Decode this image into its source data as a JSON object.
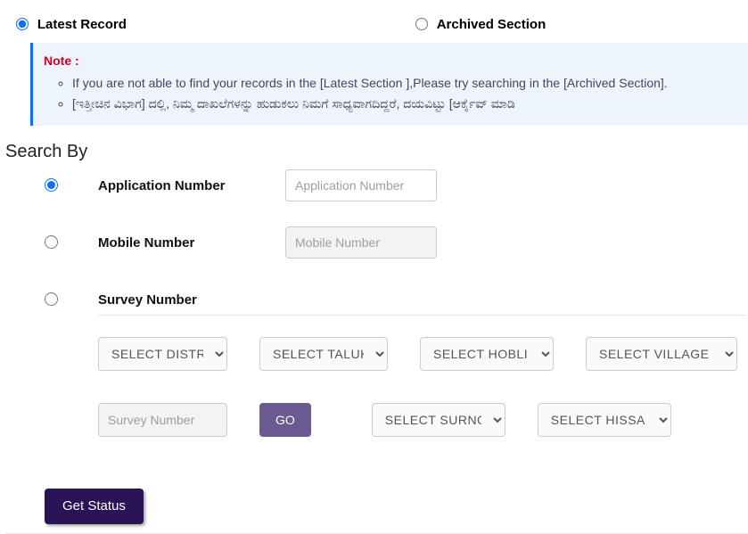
{
  "section_radios": {
    "latest_label": "Latest Record",
    "archived_label": "Archived Section"
  },
  "note": {
    "title": "Note :",
    "line1": "If you are not able to find your records in the [Latest Section ],Please try searching in the [Archived Section].",
    "line2": "[ಇತ್ತೀಚಿನ ವಿಭಾಗ] ದಲ್ಲಿ, ನಿಮ್ಮ ದಾಖಲೆಗಳನ್ನು ಹುಡುಕಲು ನಿಮಗೆ ಸಾಧ್ಯವಾಗದಿದ್ದರೆ, ದಯವಿಟ್ಟು [ಆರ್ಕೈವ್ ಮಾಡಿ"
  },
  "search_by_heading": "Search By",
  "search_options": {
    "app_number_label": "Application Number",
    "app_number_placeholder": "Application Number",
    "mobile_label": "Mobile Number",
    "mobile_placeholder": "Mobile Number",
    "survey_label": "Survey Number"
  },
  "survey": {
    "district_placeholder": "SELECT DISTRICT",
    "taluk_placeholder": "SELECT TALUK",
    "hobli_placeholder": "SELECT HOBLI",
    "village_placeholder": "SELECT VILLAGE",
    "survey_number_placeholder": "Survey Number",
    "go_label": "GO",
    "surnoc_placeholder": "SELECT SURNOC",
    "hissa_placeholder": "SELECT HISSA"
  },
  "get_status_label": "Get Status"
}
